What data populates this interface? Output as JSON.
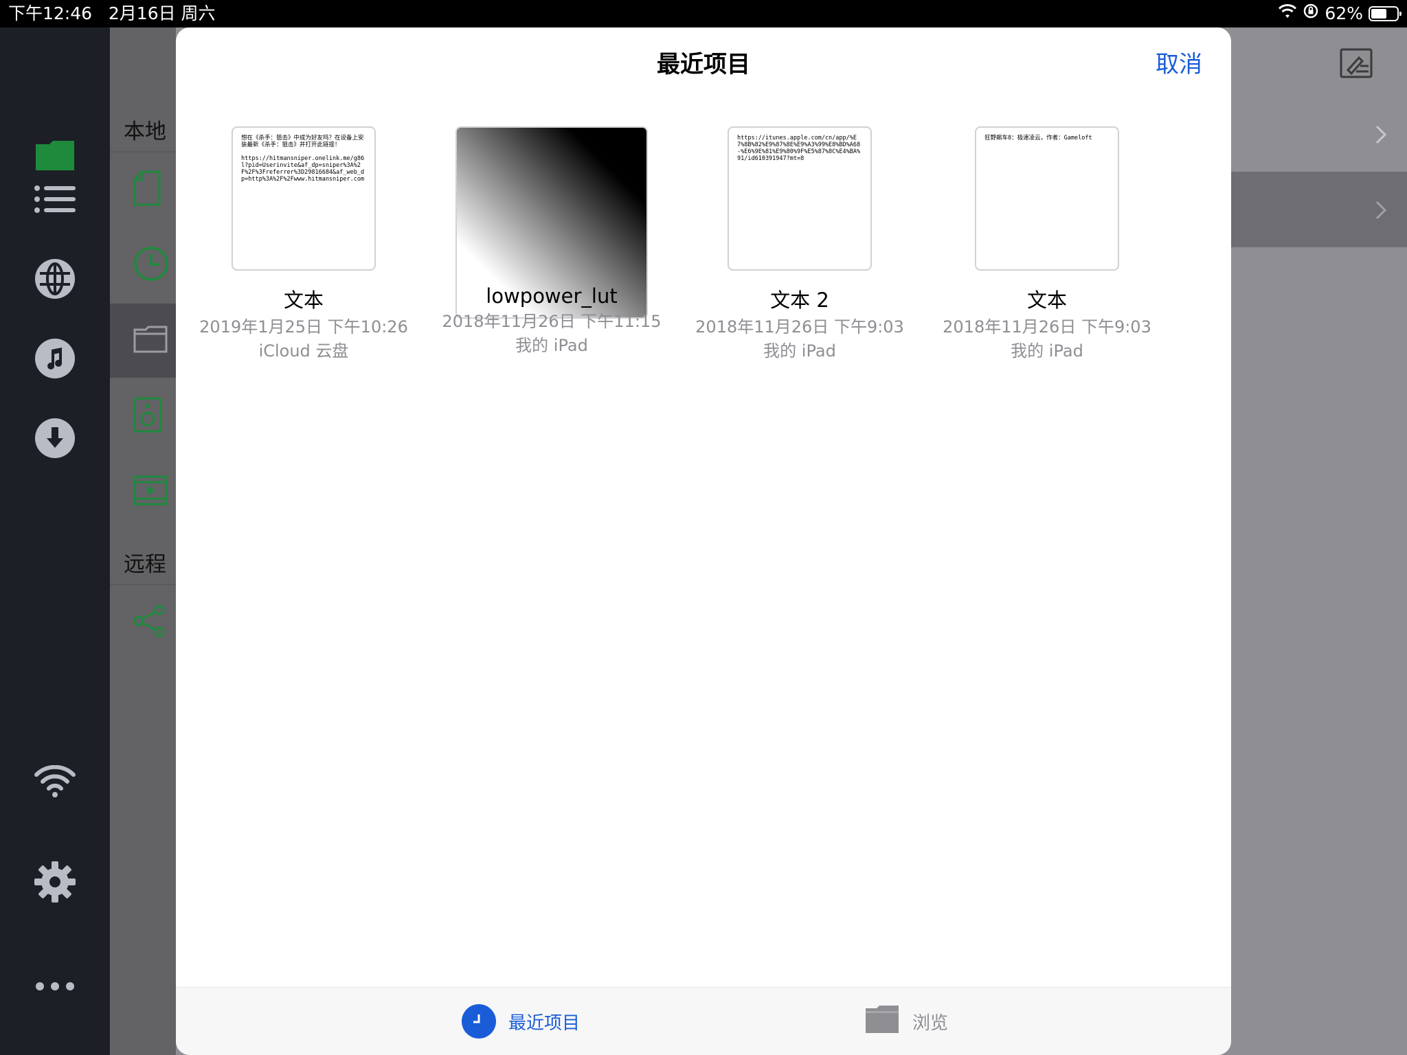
{
  "status_bar": {
    "time_date": "下午12:46   2月16日 周六",
    "battery_text": "62%",
    "battery_level": 0.62
  },
  "sidebar_panel": {
    "local_header": "本地",
    "remote_header": "远程"
  },
  "sheet": {
    "title": "最近项目",
    "cancel_label": "取消",
    "items": [
      {
        "name": "文本",
        "date": "2019年1月25日 下午10:26",
        "location": "iCloud 云盘",
        "preview": "想在《杀手：狙击》中成为好友吗？在设备上安装最新《杀手：狙击》并打开此链接！\n\nhttps://hitmansniper.onelink.me/g86l?pid=Userinvite&af_dp=sniper%3A%2F%2F%3Freferrer%3D29816684&af_web_dp=http%3A%2F%2Fwww.hitmansniper.com"
      },
      {
        "name": "lowpower_lut",
        "date": "2018年11月26日 下午11:15",
        "location": "我的 iPad",
        "preview": ""
      },
      {
        "name": "文本 2",
        "date": "2018年11月26日 下午9:03",
        "location": "我的 iPad",
        "preview": "https://itunes.apple.com/cn/app/%E7%8B%82%E9%87%8E%E9%A3%99%E8%BD%A68-%E6%9E%81%E9%80%9F%E5%87%8C%E4%BA%91/id610391947?mt=8"
      },
      {
        "name": "文本",
        "date": "2018年11月26日 下午9:03",
        "location": "我的 iPad",
        "preview": "狂野飙车8：极速凌云，作者：Gameloft"
      }
    ]
  },
  "tabbar": {
    "recent_label": "最近项目",
    "browse_label": "浏览"
  },
  "colors": {
    "accent": "#1a5cd8",
    "rail_bg": "#1c1f26",
    "icon_green": "#1e8a3c"
  }
}
